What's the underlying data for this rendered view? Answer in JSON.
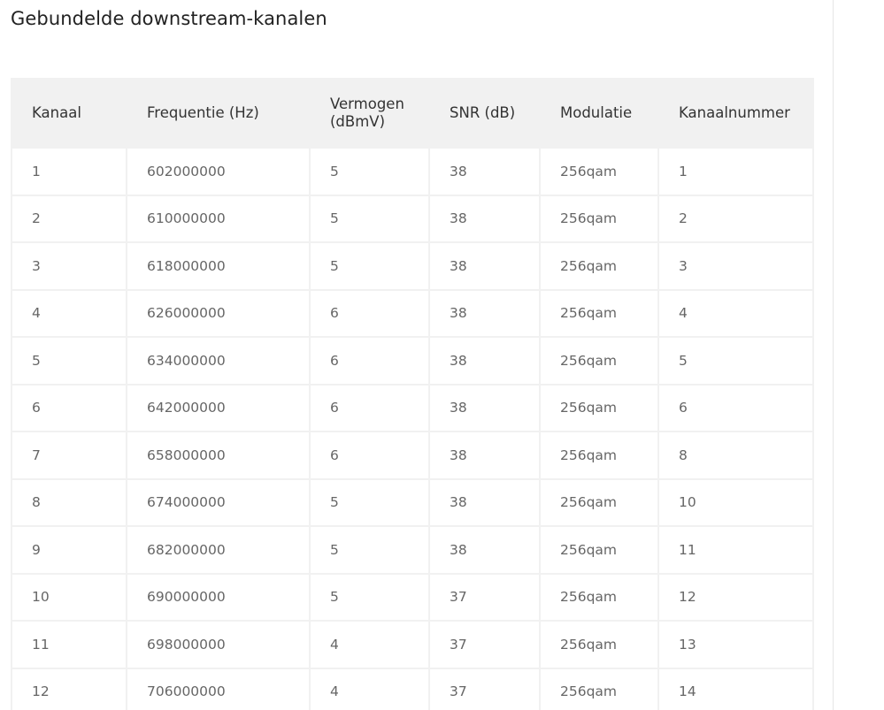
{
  "page": {
    "title": "Gebundelde downstream-kanalen"
  },
  "table": {
    "headers": [
      "Kanaal",
      "Frequentie (Hz)",
      "Vermogen (dBmV)",
      "SNR (dB)",
      "Modulatie",
      "Kanaalnummer"
    ],
    "rows": [
      [
        "1",
        "602000000",
        "5",
        "38",
        "256qam",
        "1"
      ],
      [
        "2",
        "610000000",
        "5",
        "38",
        "256qam",
        "2"
      ],
      [
        "3",
        "618000000",
        "5",
        "38",
        "256qam",
        "3"
      ],
      [
        "4",
        "626000000",
        "6",
        "38",
        "256qam",
        "4"
      ],
      [
        "5",
        "634000000",
        "6",
        "38",
        "256qam",
        "5"
      ],
      [
        "6",
        "642000000",
        "6",
        "38",
        "256qam",
        "6"
      ],
      [
        "7",
        "658000000",
        "6",
        "38",
        "256qam",
        "8"
      ],
      [
        "8",
        "674000000",
        "5",
        "38",
        "256qam",
        "10"
      ],
      [
        "9",
        "682000000",
        "5",
        "38",
        "256qam",
        "11"
      ],
      [
        "10",
        "690000000",
        "5",
        "37",
        "256qam",
        "12"
      ],
      [
        "11",
        "698000000",
        "4",
        "37",
        "256qam",
        "13"
      ],
      [
        "12",
        "706000000",
        "4",
        "37",
        "256qam",
        "14"
      ]
    ]
  }
}
